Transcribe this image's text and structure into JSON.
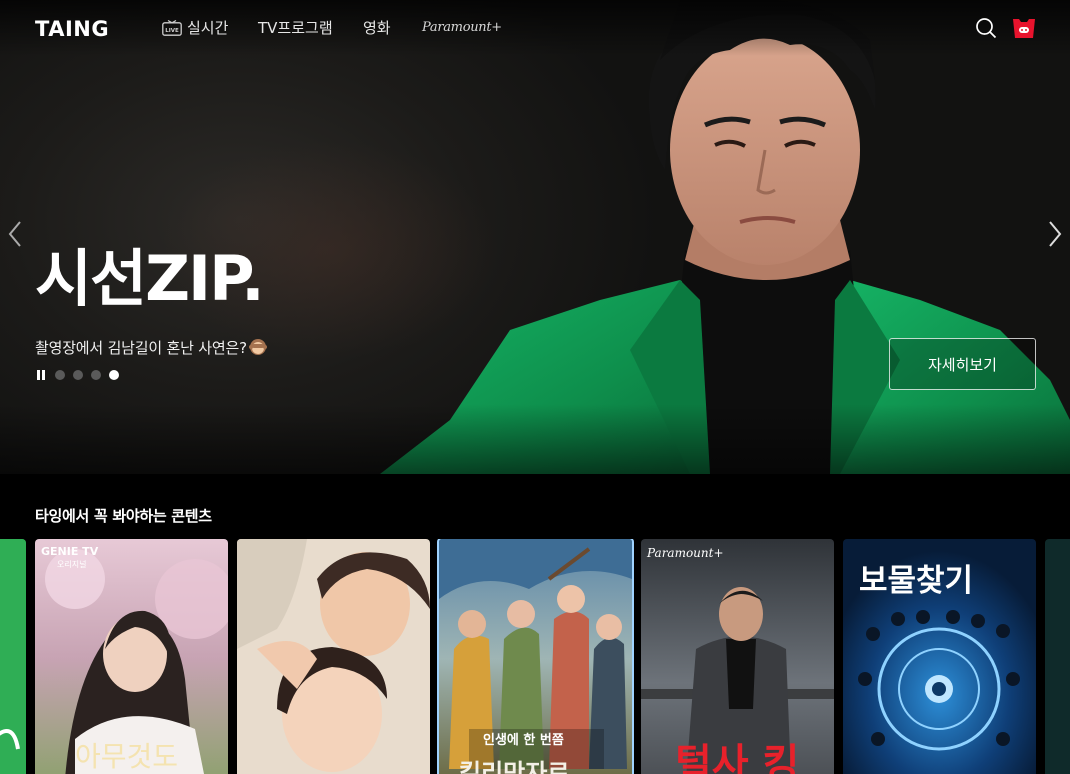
{
  "header": {
    "logo_text": "TAING",
    "nav": {
      "live_label": "실시간",
      "live_icon_text": "LIVE",
      "tv_label": "TV프로그램",
      "movie_label": "영화",
      "paramount_label": "Paramount+"
    },
    "icons": [
      "tv-live-icon",
      "search-icon",
      "profile-icon"
    ]
  },
  "hero": {
    "title_logo_text": "시선ZIP.",
    "description": "촬영장에서 김남길이 혼난 사연은?",
    "description_emoji": "see-no-evil-monkey",
    "slides_total": 4,
    "slide_active_index": 4,
    "detail_button_label": "자세히보기",
    "playback_state": "playing"
  },
  "section": {
    "title": "타잉에서 꼭 봐야하는 콘텐츠",
    "posters": [
      {
        "name": "poster-partial-green"
      },
      {
        "name": "poster-genie-tv",
        "brand": "GENIE TV",
        "sub": "오리지널",
        "title": "아무것도"
      },
      {
        "name": "poster-couple"
      },
      {
        "name": "poster-adventure",
        "title": "인생에 한 번쯤",
        "title2": "킬리만자로",
        "selected": true
      },
      {
        "name": "poster-paramount",
        "brand": "Paramount+",
        "title": "털사 킹"
      },
      {
        "name": "poster-treasure",
        "title": "보물찾기"
      }
    ]
  },
  "colors": {
    "background": "#000000",
    "accent_red": "#e8132d",
    "hero_jacket_green": "#0f9a55",
    "selected_border": "#9fd3ff"
  }
}
